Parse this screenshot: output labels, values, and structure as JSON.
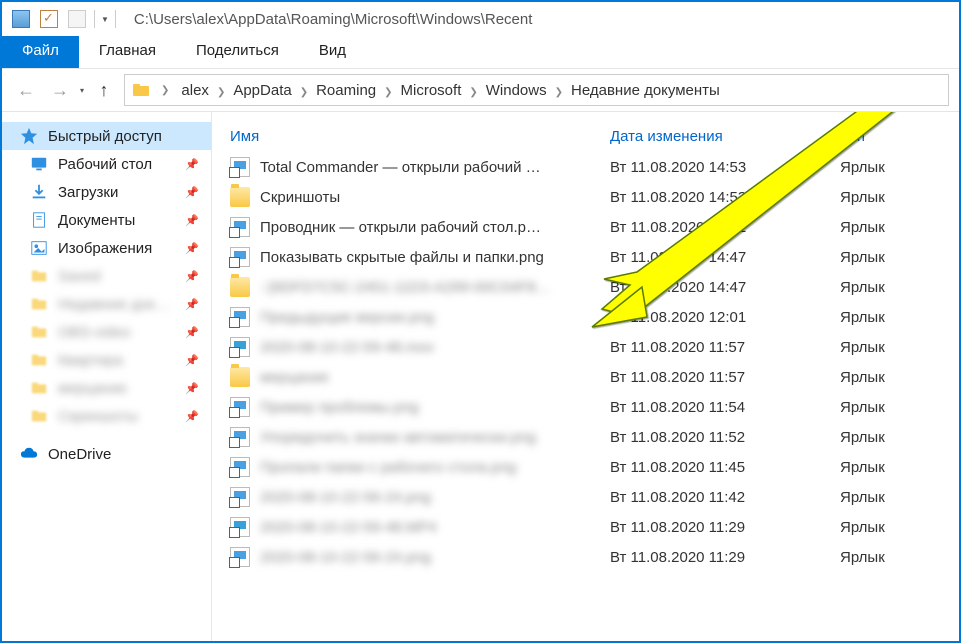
{
  "title_path": "C:\\Users\\alex\\AppData\\Roaming\\Microsoft\\Windows\\Recent",
  "ribbon": {
    "file": "Файл",
    "home": "Главная",
    "share": "Поделиться",
    "view": "Вид"
  },
  "breadcrumb": [
    "alex",
    "AppData",
    "Roaming",
    "Microsoft",
    "Windows",
    "Недавние документы"
  ],
  "columns": {
    "name": "Имя",
    "date": "Дата изменения",
    "type": "Тип"
  },
  "sidebar": {
    "quick_access": "Быстрый доступ",
    "items": [
      {
        "label": "Рабочий стол",
        "icon": "desktop",
        "pinned": true
      },
      {
        "label": "Загрузки",
        "icon": "downloads",
        "pinned": true
      },
      {
        "label": "Документы",
        "icon": "documents",
        "pinned": true
      },
      {
        "label": "Изображения",
        "icon": "pictures",
        "pinned": true
      },
      {
        "label": "Saved",
        "icon": "folder",
        "pinned": true,
        "blurred": true
      },
      {
        "label": "Недавние документы",
        "icon": "folder",
        "pinned": true,
        "blurred": true
      },
      {
        "label": "OBS-video",
        "icon": "folder",
        "pinned": true,
        "blurred": true
      },
      {
        "label": "Квартира",
        "icon": "folder",
        "pinned": true,
        "blurred": true
      },
      {
        "label": "мерцание",
        "icon": "folder",
        "pinned": true,
        "blurred": true
      },
      {
        "label": "Скриншоты",
        "icon": "folder",
        "pinned": true,
        "blurred": true
      }
    ],
    "onedrive": "OneDrive"
  },
  "files": [
    {
      "name": "Total Commander — открыли рабочий …",
      "date": "Вт 11.08.2020 14:53",
      "type": "Ярлык",
      "icon": "img"
    },
    {
      "name": "Скриншоты",
      "date": "Вт 11.08.2020 14:53",
      "type": "Ярлык",
      "icon": "folder"
    },
    {
      "name": "Проводник — открыли рабочий стол.p…",
      "date": "Вт 11.08.2020 14:51",
      "type": "Ярлык",
      "icon": "img"
    },
    {
      "name": "Показывать скрытые файлы и папки.png",
      "date": "Вт 11.08.2020 14:47",
      "type": "Ярлык",
      "icon": "img"
    },
    {
      "name": "::{6DFD7C5C-2451-11D3-A299-00C04F8…",
      "date": "Вт 11.08.2020 14:47",
      "type": "Ярлык",
      "icon": "folder",
      "blurred": true
    },
    {
      "name": "Предыдущие версии.png",
      "date": "Вт 11.08.2020 12:01",
      "type": "Ярлык",
      "icon": "img",
      "blurred": true
    },
    {
      "name": "2020-08-10-22-59-48.mov",
      "date": "Вт 11.08.2020 11:57",
      "type": "Ярлык",
      "icon": "video",
      "blurred": true
    },
    {
      "name": "мерцание",
      "date": "Вт 11.08.2020 11:57",
      "type": "Ярлык",
      "icon": "folder",
      "blurred": true
    },
    {
      "name": "Пример проблемы.png",
      "date": "Вт 11.08.2020 11:54",
      "type": "Ярлык",
      "icon": "img",
      "blurred": true
    },
    {
      "name": "Упорядочить значки автоматически.png",
      "date": "Вт 11.08.2020 11:52",
      "type": "Ярлык",
      "icon": "img",
      "blurred": true
    },
    {
      "name": "Пропали папки с рабочего стола.png",
      "date": "Вт 11.08.2020 11:45",
      "type": "Ярлык",
      "icon": "img",
      "blurred": true
    },
    {
      "name": "2020-08-10-22-56-24.png",
      "date": "Вт 11.08.2020 11:42",
      "type": "Ярлык",
      "icon": "img",
      "blurred": true
    },
    {
      "name": "2020-08-10-22-59-48.MP4",
      "date": "Вт 11.08.2020 11:29",
      "type": "Ярлык",
      "icon": "video",
      "blurred": true
    },
    {
      "name": "2020-08-10-22-56-24.png",
      "date": "Вт 11.08.2020 11:29",
      "type": "Ярлык",
      "icon": "img",
      "blurred": true
    }
  ]
}
